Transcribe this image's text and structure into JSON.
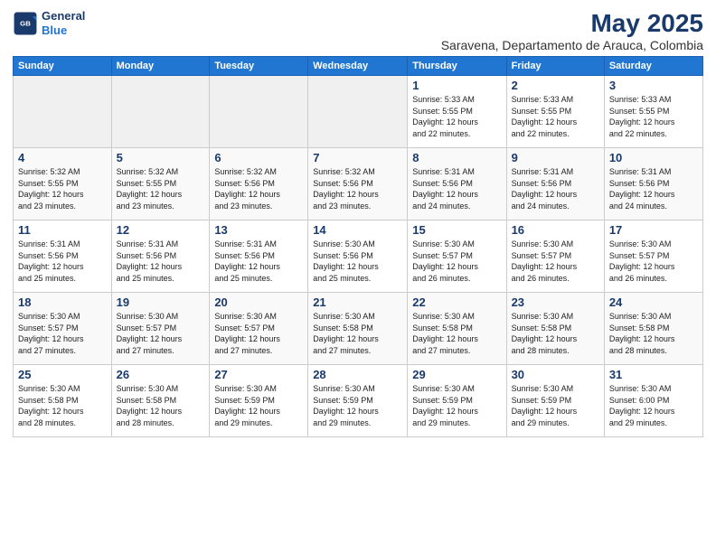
{
  "logo": {
    "line1": "General",
    "line2": "Blue"
  },
  "title": "May 2025",
  "subtitle": "Saravena, Departamento de Arauca, Colombia",
  "weekdays": [
    "Sunday",
    "Monday",
    "Tuesday",
    "Wednesday",
    "Thursday",
    "Friday",
    "Saturday"
  ],
  "weeks": [
    [
      {
        "day": "",
        "info": ""
      },
      {
        "day": "",
        "info": ""
      },
      {
        "day": "",
        "info": ""
      },
      {
        "day": "",
        "info": ""
      },
      {
        "day": "1",
        "info": "Sunrise: 5:33 AM\nSunset: 5:55 PM\nDaylight: 12 hours\nand 22 minutes."
      },
      {
        "day": "2",
        "info": "Sunrise: 5:33 AM\nSunset: 5:55 PM\nDaylight: 12 hours\nand 22 minutes."
      },
      {
        "day": "3",
        "info": "Sunrise: 5:33 AM\nSunset: 5:55 PM\nDaylight: 12 hours\nand 22 minutes."
      }
    ],
    [
      {
        "day": "4",
        "info": "Sunrise: 5:32 AM\nSunset: 5:55 PM\nDaylight: 12 hours\nand 23 minutes."
      },
      {
        "day": "5",
        "info": "Sunrise: 5:32 AM\nSunset: 5:55 PM\nDaylight: 12 hours\nand 23 minutes."
      },
      {
        "day": "6",
        "info": "Sunrise: 5:32 AM\nSunset: 5:56 PM\nDaylight: 12 hours\nand 23 minutes."
      },
      {
        "day": "7",
        "info": "Sunrise: 5:32 AM\nSunset: 5:56 PM\nDaylight: 12 hours\nand 23 minutes."
      },
      {
        "day": "8",
        "info": "Sunrise: 5:31 AM\nSunset: 5:56 PM\nDaylight: 12 hours\nand 24 minutes."
      },
      {
        "day": "9",
        "info": "Sunrise: 5:31 AM\nSunset: 5:56 PM\nDaylight: 12 hours\nand 24 minutes."
      },
      {
        "day": "10",
        "info": "Sunrise: 5:31 AM\nSunset: 5:56 PM\nDaylight: 12 hours\nand 24 minutes."
      }
    ],
    [
      {
        "day": "11",
        "info": "Sunrise: 5:31 AM\nSunset: 5:56 PM\nDaylight: 12 hours\nand 25 minutes."
      },
      {
        "day": "12",
        "info": "Sunrise: 5:31 AM\nSunset: 5:56 PM\nDaylight: 12 hours\nand 25 minutes."
      },
      {
        "day": "13",
        "info": "Sunrise: 5:31 AM\nSunset: 5:56 PM\nDaylight: 12 hours\nand 25 minutes."
      },
      {
        "day": "14",
        "info": "Sunrise: 5:30 AM\nSunset: 5:56 PM\nDaylight: 12 hours\nand 25 minutes."
      },
      {
        "day": "15",
        "info": "Sunrise: 5:30 AM\nSunset: 5:57 PM\nDaylight: 12 hours\nand 26 minutes."
      },
      {
        "day": "16",
        "info": "Sunrise: 5:30 AM\nSunset: 5:57 PM\nDaylight: 12 hours\nand 26 minutes."
      },
      {
        "day": "17",
        "info": "Sunrise: 5:30 AM\nSunset: 5:57 PM\nDaylight: 12 hours\nand 26 minutes."
      }
    ],
    [
      {
        "day": "18",
        "info": "Sunrise: 5:30 AM\nSunset: 5:57 PM\nDaylight: 12 hours\nand 27 minutes."
      },
      {
        "day": "19",
        "info": "Sunrise: 5:30 AM\nSunset: 5:57 PM\nDaylight: 12 hours\nand 27 minutes."
      },
      {
        "day": "20",
        "info": "Sunrise: 5:30 AM\nSunset: 5:57 PM\nDaylight: 12 hours\nand 27 minutes."
      },
      {
        "day": "21",
        "info": "Sunrise: 5:30 AM\nSunset: 5:58 PM\nDaylight: 12 hours\nand 27 minutes."
      },
      {
        "day": "22",
        "info": "Sunrise: 5:30 AM\nSunset: 5:58 PM\nDaylight: 12 hours\nand 27 minutes."
      },
      {
        "day": "23",
        "info": "Sunrise: 5:30 AM\nSunset: 5:58 PM\nDaylight: 12 hours\nand 28 minutes."
      },
      {
        "day": "24",
        "info": "Sunrise: 5:30 AM\nSunset: 5:58 PM\nDaylight: 12 hours\nand 28 minutes."
      }
    ],
    [
      {
        "day": "25",
        "info": "Sunrise: 5:30 AM\nSunset: 5:58 PM\nDaylight: 12 hours\nand 28 minutes."
      },
      {
        "day": "26",
        "info": "Sunrise: 5:30 AM\nSunset: 5:58 PM\nDaylight: 12 hours\nand 28 minutes."
      },
      {
        "day": "27",
        "info": "Sunrise: 5:30 AM\nSunset: 5:59 PM\nDaylight: 12 hours\nand 29 minutes."
      },
      {
        "day": "28",
        "info": "Sunrise: 5:30 AM\nSunset: 5:59 PM\nDaylight: 12 hours\nand 29 minutes."
      },
      {
        "day": "29",
        "info": "Sunrise: 5:30 AM\nSunset: 5:59 PM\nDaylight: 12 hours\nand 29 minutes."
      },
      {
        "day": "30",
        "info": "Sunrise: 5:30 AM\nSunset: 5:59 PM\nDaylight: 12 hours\nand 29 minutes."
      },
      {
        "day": "31",
        "info": "Sunrise: 5:30 AM\nSunset: 6:00 PM\nDaylight: 12 hours\nand 29 minutes."
      }
    ]
  ]
}
